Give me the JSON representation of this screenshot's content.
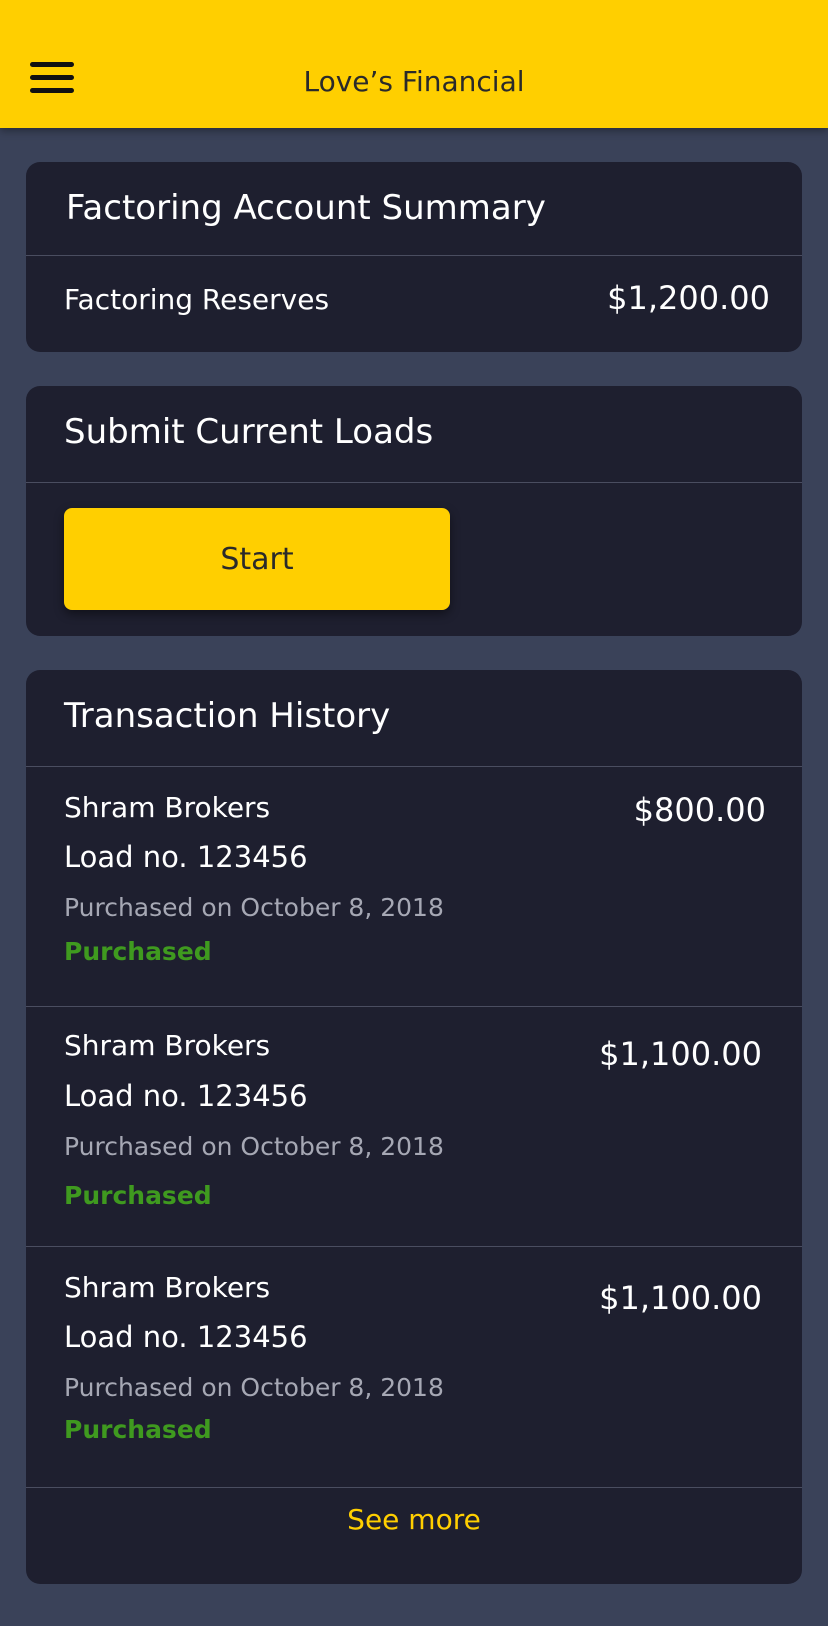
{
  "app": {
    "title": "Love’s Financial"
  },
  "summary": {
    "title": "Factoring Account Summary",
    "reserves_label": "Factoring Reserves",
    "reserves_value": "$1,200.00"
  },
  "submit": {
    "title": "Submit Current Loads",
    "start_label": "Start"
  },
  "history": {
    "title": "Transaction History",
    "transactions": [
      {
        "broker": "Shram Brokers",
        "load": "Load no. 123456",
        "date": "Purchased on October 8, 2018",
        "status": "Purchased",
        "amount": "$800.00"
      },
      {
        "broker": "Shram Brokers",
        "load": "Load no. 123456",
        "date": "Purchased on October 8, 2018",
        "status": "Purchased",
        "amount": "$1,100.00"
      },
      {
        "broker": "Shram Brokers",
        "load": "Load no. 123456",
        "date": "Purchased on October 8, 2018",
        "status": "Purchased",
        "amount": "$1,100.00"
      }
    ],
    "see_more_label": "See more"
  },
  "colors": {
    "accent": "#ffcf00",
    "background": "#3a4259",
    "card": "#1e1f2f",
    "status_purchased": "#3f9a1f"
  },
  "icons": {
    "menu": "hamburger-menu-icon"
  }
}
